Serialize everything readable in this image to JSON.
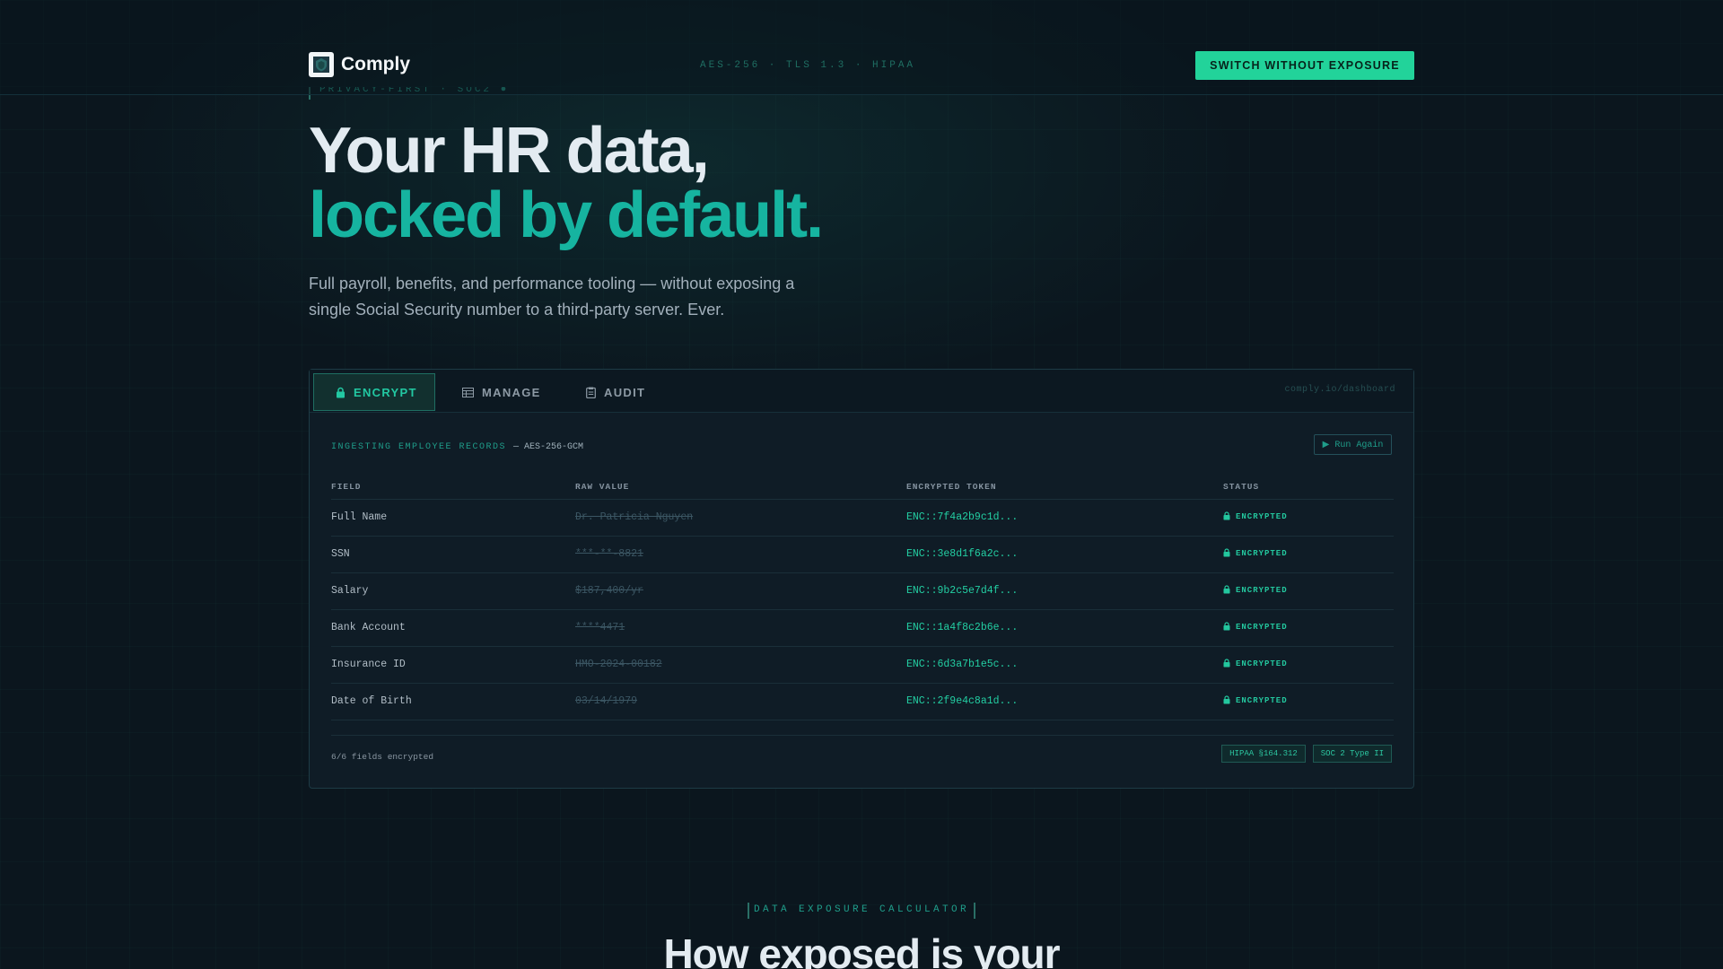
{
  "nav": {
    "brand": "Comply",
    "tags": "AES-256 · TLS 1.3 · HIPAA",
    "cta": "SWITCH WITHOUT EXPOSURE"
  },
  "hero": {
    "eyebrow": "PRIVACY-FIRST · SOC2 ●",
    "title_line1": "Your HR data,",
    "title_line2": "locked by default.",
    "subtitle": "Full payroll, benefits, and performance tooling — without exposing a single Social Security number to a third-party server. Ever."
  },
  "panel": {
    "tabs": [
      {
        "label": "ENCRYPT",
        "icon": "lock-icon",
        "active": true
      },
      {
        "label": "MANAGE",
        "icon": "table-icon",
        "active": false
      },
      {
        "label": "AUDIT",
        "icon": "clipboard-icon",
        "active": false
      }
    ],
    "url": "comply.io/dashboard",
    "ingest_label": "INGESTING EMPLOYEE RECORDS",
    "ingest_algo": "— AES-256-GCM",
    "run_again": "▶ Run Again",
    "columns": [
      "FIELD",
      "RAW VALUE",
      "ENCRYPTED TOKEN",
      "STATUS"
    ],
    "rows": [
      {
        "field": "Full Name",
        "raw": "Dr. Patricia Nguyen",
        "token": "ENC::7f4a2b9c1d...",
        "status": "ENCRYPTED"
      },
      {
        "field": "SSN",
        "raw": "***-**-8821",
        "token": "ENC::3e8d1f6a2c...",
        "status": "ENCRYPTED"
      },
      {
        "field": "Salary",
        "raw": "$187,400/yr",
        "token": "ENC::9b2c5e7d4f...",
        "status": "ENCRYPTED"
      },
      {
        "field": "Bank Account",
        "raw": "****4471",
        "token": "ENC::1a4f8c2b6e...",
        "status": "ENCRYPTED"
      },
      {
        "field": "Insurance ID",
        "raw": "HMO-2024-00182",
        "token": "ENC::6d3a7b1e5c...",
        "status": "ENCRYPTED"
      },
      {
        "field": "Date of Birth",
        "raw": "03/14/1979",
        "token": "ENC::2f9e4c8a1d...",
        "status": "ENCRYPTED"
      }
    ],
    "fields_count": "6/6 fields encrypted",
    "badges": [
      "HIPAA §164.312",
      "SOC 2 Type II"
    ]
  },
  "calculator": {
    "eyebrow": "DATA EXPOSURE CALCULATOR",
    "title": "How exposed is your"
  },
  "colors": {
    "accent": "#22d39a",
    "teal": "#16b4a0",
    "background": "#0b161e"
  }
}
